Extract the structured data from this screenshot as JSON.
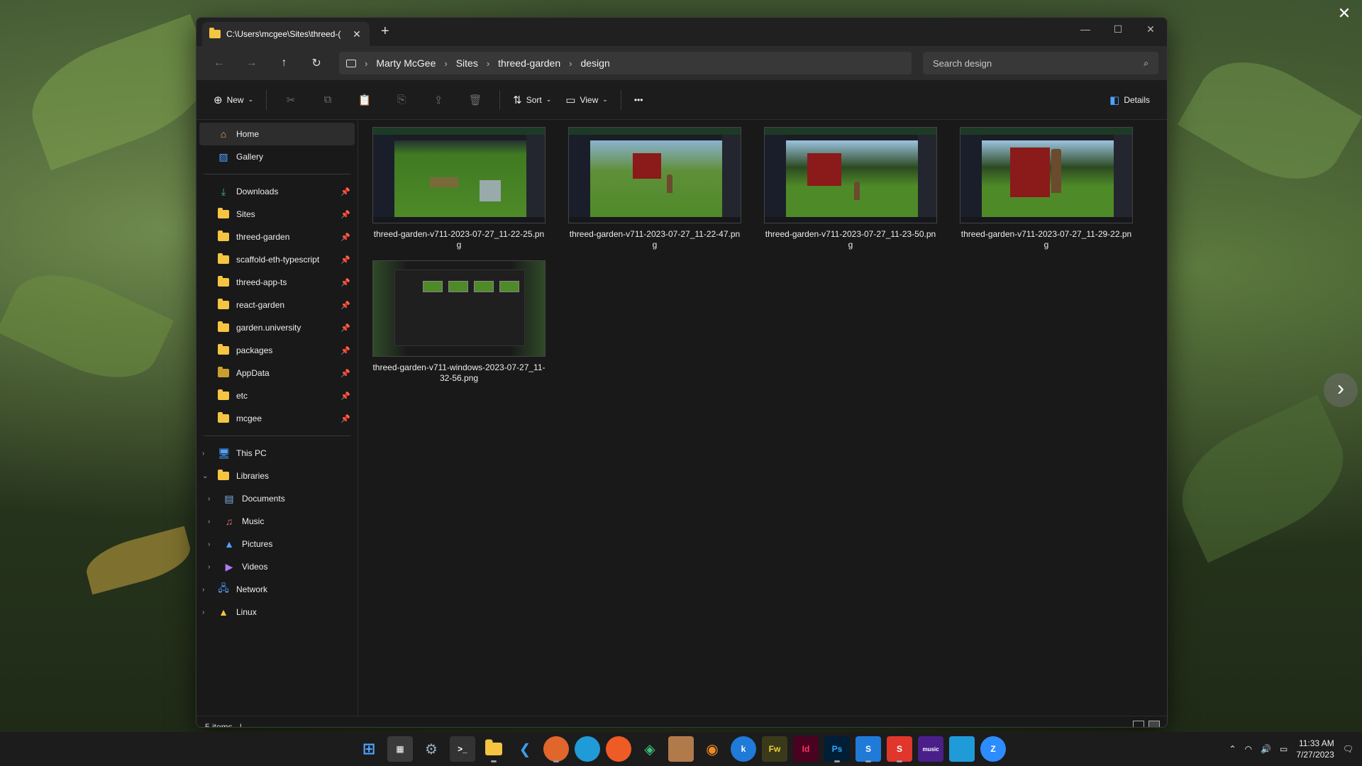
{
  "window": {
    "tab_title": "C:\\Users\\mcgee\\Sites\\threed-(",
    "tab_close": "✕",
    "new_tab": "+",
    "controls": {
      "minimize": "—",
      "maximize": "☐",
      "close": "✕"
    }
  },
  "nav": {
    "back": "←",
    "forward": "→",
    "up": "↑",
    "refresh": "↻",
    "breadcrumbs": [
      "Marty McGee",
      "Sites",
      "threed-garden",
      "design"
    ],
    "search_placeholder": "Search design"
  },
  "commands": {
    "new_label": "New",
    "sort_label": "Sort",
    "view_label": "View",
    "more_label": "•••",
    "details_label": "Details"
  },
  "sidebar": {
    "top": [
      {
        "label": "Home",
        "icon": "home-icon"
      },
      {
        "label": "Gallery",
        "icon": "gallery-icon"
      }
    ],
    "pinned": [
      {
        "label": "Downloads",
        "icon": "download-icon"
      },
      {
        "label": "Sites",
        "icon": "folder-icon"
      },
      {
        "label": "threed-garden",
        "icon": "folder-icon"
      },
      {
        "label": "scaffold-eth-typescript",
        "icon": "folder-icon"
      },
      {
        "label": "threed-app-ts",
        "icon": "folder-icon"
      },
      {
        "label": "react-garden",
        "icon": "folder-icon"
      },
      {
        "label": "garden.university",
        "icon": "folder-icon"
      },
      {
        "label": "packages",
        "icon": "folder-icon"
      },
      {
        "label": "AppData",
        "icon": "folder-icon"
      },
      {
        "label": "etc",
        "icon": "folder-icon"
      },
      {
        "label": "mcgee",
        "icon": "folder-icon"
      }
    ],
    "tree": [
      {
        "label": "This PC",
        "icon": "pc-icon"
      },
      {
        "label": "Libraries",
        "icon": "folder-icon"
      },
      {
        "label": "Documents",
        "icon": "documents-icon"
      },
      {
        "label": "Music",
        "icon": "music-icon"
      },
      {
        "label": "Pictures",
        "icon": "pictures-icon"
      },
      {
        "label": "Videos",
        "icon": "videos-icon"
      },
      {
        "label": "Network",
        "icon": "network-icon"
      },
      {
        "label": "Linux",
        "icon": "linux-icon"
      }
    ]
  },
  "files": [
    {
      "name": "threed-garden-v711-2023-07-27_11-22-25.png"
    },
    {
      "name": "threed-garden-v711-2023-07-27_11-22-47.png"
    },
    {
      "name": "threed-garden-v711-2023-07-27_11-23-50.png"
    },
    {
      "name": "threed-garden-v711-2023-07-27_11-29-22.png"
    },
    {
      "name": "threed-garden-v711-windows-2023-07-27_11-32-56.png"
    }
  ],
  "status": {
    "items": "5 items"
  },
  "taskbar": {
    "apps": [
      "start-icon",
      "calculator-icon",
      "settings-icon",
      "terminal-icon",
      "file-explorer-icon",
      "vscode-icon",
      "firefox-icon",
      "edge-icon",
      "postman-icon",
      "git-icon",
      "package-icon",
      "blender-icon",
      "k-app-icon",
      "fireworks-icon",
      "indesign-icon",
      "photoshop-icon",
      "s-app-icon",
      "s-app-red-icon",
      "amazon-music-icon",
      "paint-icon",
      "zoom-icon"
    ],
    "time": "11:33 AM",
    "date": "7/27/2023"
  },
  "colors": {
    "accent": "#0078d4",
    "folder": "#f5c542",
    "window_bg": "#191919"
  }
}
